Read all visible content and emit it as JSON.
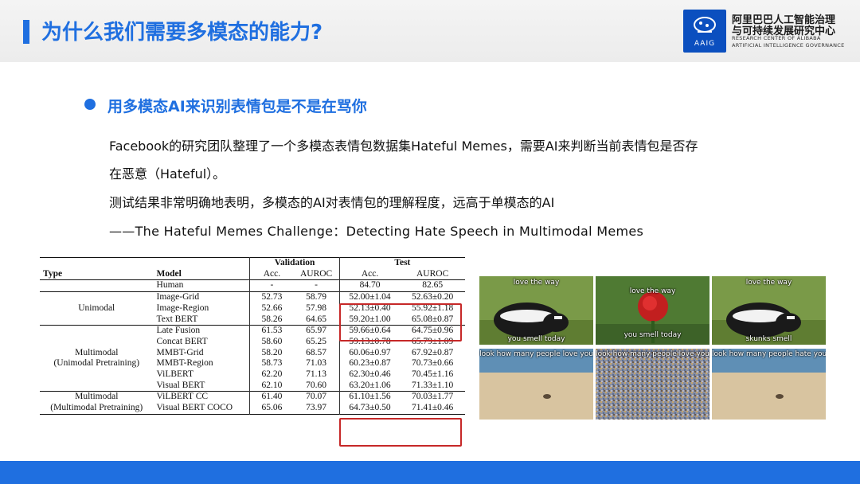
{
  "header": {
    "title": "为什么我们需要多模态的能力?",
    "org_cn_line1": "阿里巴巴人工智能治理",
    "org_cn_line2": "与可持续发展研究中心",
    "org_en_line1": "RESEARCH CENTER OF ALIBABA",
    "org_en_line2": "ARTIFICIAL INTELLIGENCE GOVERNANCE",
    "logo_abbr": "AAIG"
  },
  "content": {
    "bullet": "用多模态AI来识别表情包是不是在骂你",
    "para1": "Facebook的研究团队整理了一个多模态表情包数据集Hateful Memes，需要AI来判断当前表情包是否存",
    "para2": "在恶意（Hateful）。",
    "para3": "测试结果非常明确地表明，多模态的AI对表情包的理解程度，远高于单模态的AI",
    "citation": "——The Hateful Memes Challenge：Detecting Hate Speech in Multimodal Memes"
  },
  "table": {
    "head_type": "Type",
    "head_model": "Model",
    "head_validation": "Validation",
    "head_test": "Test",
    "head_acc": "Acc.",
    "head_auroc": "AUROC",
    "human": {
      "model": "Human",
      "v_acc": "-",
      "v_auroc": "-",
      "t_acc": "84.70",
      "t_auroc": "82.65"
    },
    "groups": [
      {
        "type_line1": "Unimodal",
        "type_line2": "",
        "rows": [
          {
            "model": "Image-Grid",
            "v_acc": "52.73",
            "v_auroc": "58.79",
            "t_acc": "52.00±1.04",
            "t_auroc": "52.63±0.20"
          },
          {
            "model": "Image-Region",
            "v_acc": "52.66",
            "v_auroc": "57.98",
            "t_acc": "52.13±0.40",
            "t_auroc": "55.92±1.18"
          },
          {
            "model": "Text BERT",
            "v_acc": "58.26",
            "v_auroc": "64.65",
            "t_acc": "59.20±1.00",
            "t_auroc": "65.08±0.87"
          }
        ]
      },
      {
        "type_line1": "Multimodal",
        "type_line2": "(Unimodal Pretraining)",
        "rows": [
          {
            "model": "Late Fusion",
            "v_acc": "61.53",
            "v_auroc": "65.97",
            "t_acc": "59.66±0.64",
            "t_auroc": "64.75±0.96"
          },
          {
            "model": "Concat BERT",
            "v_acc": "58.60",
            "v_auroc": "65.25",
            "t_acc": "59.13±0.78",
            "t_auroc": "65.79±1.09"
          },
          {
            "model": "MMBT-Grid",
            "v_acc": "58.20",
            "v_auroc": "68.57",
            "t_acc": "60.06±0.97",
            "t_auroc": "67.92±0.87"
          },
          {
            "model": "MMBT-Region",
            "v_acc": "58.73",
            "v_auroc": "71.03",
            "t_acc": "60.23±0.87",
            "t_auroc": "70.73±0.66"
          },
          {
            "model": "ViLBERT",
            "v_acc": "62.20",
            "v_auroc": "71.13",
            "t_acc": "62.30±0.46",
            "t_auroc": "70.45±1.16"
          },
          {
            "model": "Visual BERT",
            "v_acc": "62.10",
            "v_auroc": "70.60",
            "t_acc": "63.20±1.06",
            "t_auroc": "71.33±1.10"
          }
        ]
      },
      {
        "type_line1": "Multimodal",
        "type_line2": "(Multimodal Pretraining)",
        "rows": [
          {
            "model": "ViLBERT CC",
            "v_acc": "61.40",
            "v_auroc": "70.07",
            "t_acc": "61.10±1.56",
            "t_auroc": "70.03±1.77"
          },
          {
            "model": "Visual BERT COCO",
            "v_acc": "65.06",
            "v_auroc": "73.97",
            "t_acc": "64.73±0.50",
            "t_auroc": "71.41±0.46"
          }
        ]
      }
    ]
  },
  "memes": {
    "top": [
      "love the way",
      "love the way",
      "love the way"
    ],
    "bottom": [
      "you smell today",
      "you smell today",
      "skunks smell"
    ],
    "top2": [
      "look how many people love you",
      "look how many people love you",
      "look how many people hate you"
    ]
  },
  "colors": {
    "accent": "#1f6fe0",
    "highlight_box": "#c62828"
  }
}
